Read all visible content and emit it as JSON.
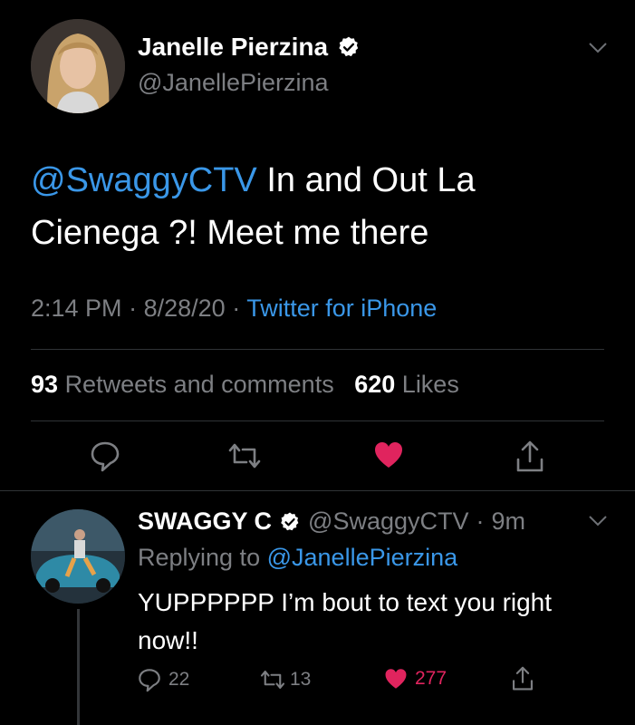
{
  "tweet": {
    "display_name": "Janelle Pierzina",
    "handle": "@JanellePierzina",
    "mention": "@SwaggyCTV",
    "text": " In and Out La Cienega ?! Meet me there",
    "time": "2:14 PM",
    "date": "8/28/20",
    "source": "Twitter for iPhone",
    "retweets_count": "93",
    "retweets_label": "Retweets and comments",
    "likes_count": "620",
    "likes_label": "Likes",
    "liked": true
  },
  "reply": {
    "display_name": "SWAGGY C",
    "handle": "@SwaggyCTV",
    "age": "9m",
    "replying_label": "Replying to",
    "replying_to": "@JanellePierzina",
    "text": "YUPPPPPP I’m bout to text you right now!!",
    "comments": "22",
    "retweets": "13",
    "likes": "277",
    "liked": true
  },
  "colors": {
    "background": "#000000",
    "text": "#ffffff",
    "secondary": "#7d7f83",
    "link": "#3a97e8",
    "like": "#e0245e",
    "divider": "#2f3336"
  },
  "icons": [
    "verified-badge-icon",
    "chevron-down-icon",
    "reply-icon",
    "retweet-icon",
    "heart-icon",
    "share-icon"
  ]
}
